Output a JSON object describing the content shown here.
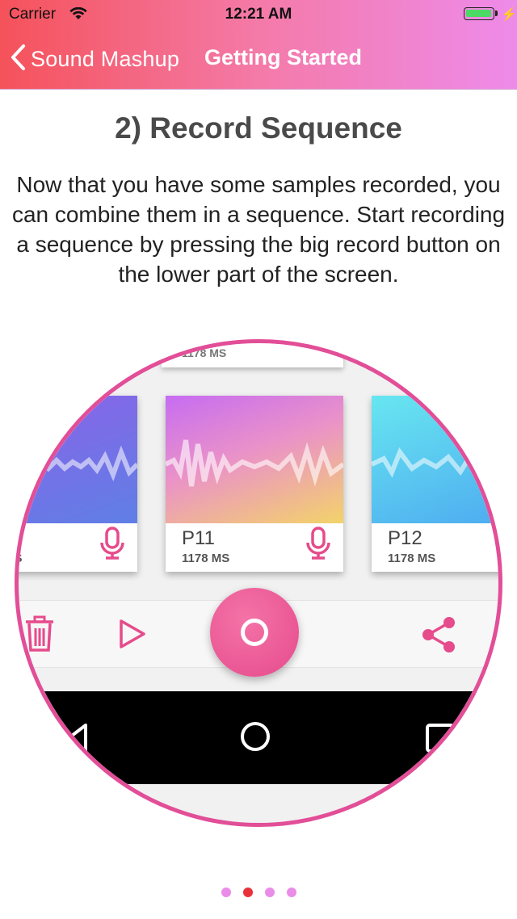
{
  "status_bar": {
    "carrier": "Carrier",
    "time": "12:21 AM"
  },
  "nav": {
    "back_label": "Sound Mashup",
    "title": "Getting Started"
  },
  "page": {
    "heading": "2) Record Sequence",
    "body": "Now that you have some samples recorded, you can combine them in a sequence. Start recording a sequence by pressing the big record button on the lower part of the screen."
  },
  "illustration": {
    "top_card_duration": "1178 MS",
    "cards": [
      {
        "name": "",
        "duration": "MS"
      },
      {
        "name": "P11",
        "duration": "1178 MS"
      },
      {
        "name": "P12",
        "duration": "1178 MS"
      }
    ],
    "accent_color": "#e64b8c"
  },
  "pagination": {
    "total": 4,
    "active_index": 1
  },
  "colors": {
    "nav_gradient": [
      "#f5525a",
      "#ee8bea"
    ],
    "dot_inactive": "#e98de8",
    "dot_active": "#e8313a"
  }
}
